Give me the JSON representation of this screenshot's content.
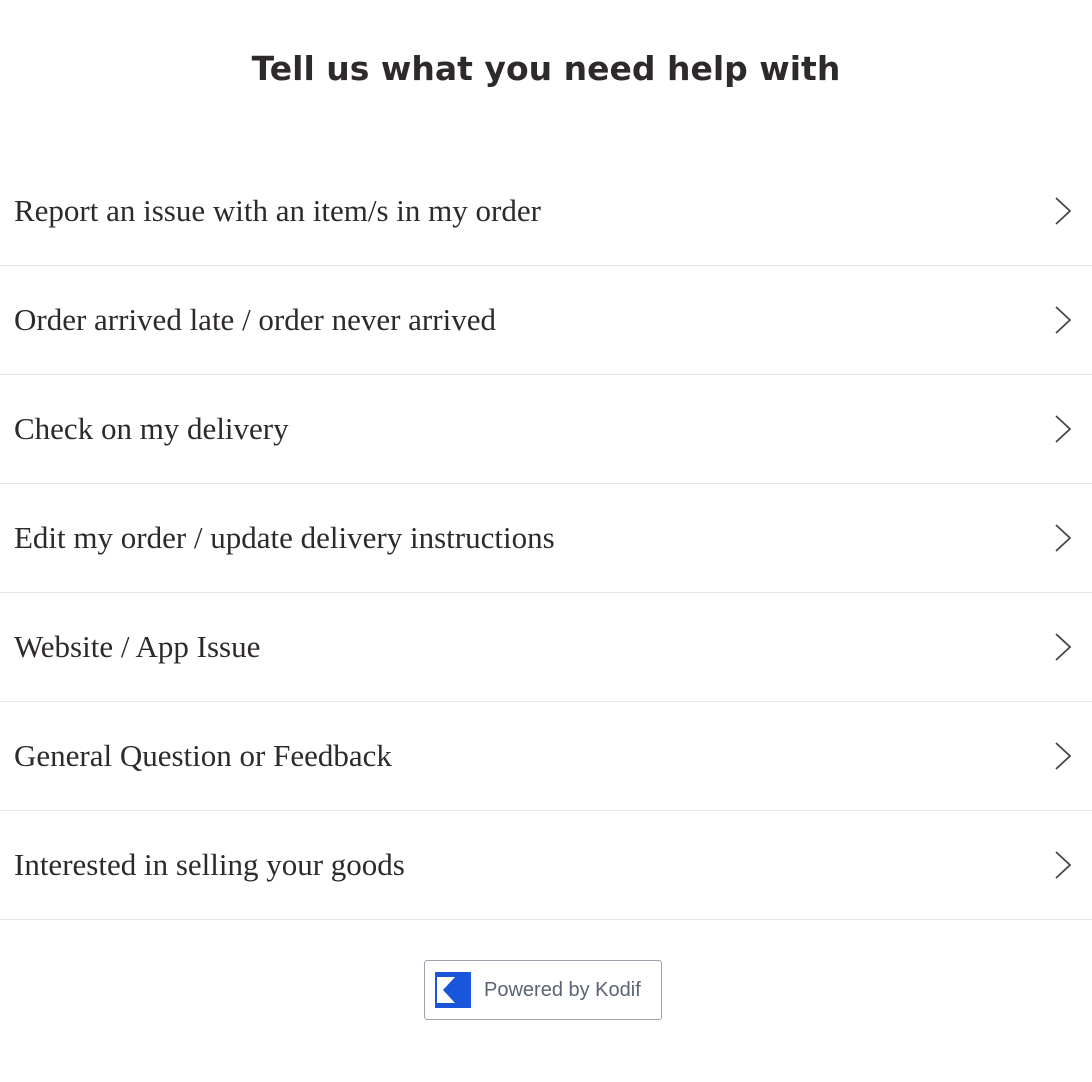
{
  "page": {
    "title": "Tell us what you need help with"
  },
  "topics": [
    {
      "label": "Report an issue with an item/s in my order",
      "icon": "chevron-right-icon"
    },
    {
      "label": "Order arrived late / order never arrived",
      "icon": "chevron-right-icon"
    },
    {
      "label": "Check on my delivery",
      "icon": "chevron-right-icon"
    },
    {
      "label": "Edit my order / update delivery instructions",
      "icon": "chevron-right-icon"
    },
    {
      "label": "Website / App Issue",
      "icon": "chevron-right-icon"
    },
    {
      "label": "General Question or Feedback",
      "icon": "chevron-right-icon"
    },
    {
      "label": "Interested in selling your goods",
      "icon": "chevron-right-icon"
    }
  ],
  "footer": {
    "powered_label": "Powered by Kodif",
    "logo_icon": "kodif-logo-icon",
    "logo_color": "#1a56db"
  },
  "colors": {
    "text": "#2e2a29",
    "divider": "#e9e7e6",
    "badge_border": "#9aa3ad",
    "badge_text": "#5b6472"
  }
}
